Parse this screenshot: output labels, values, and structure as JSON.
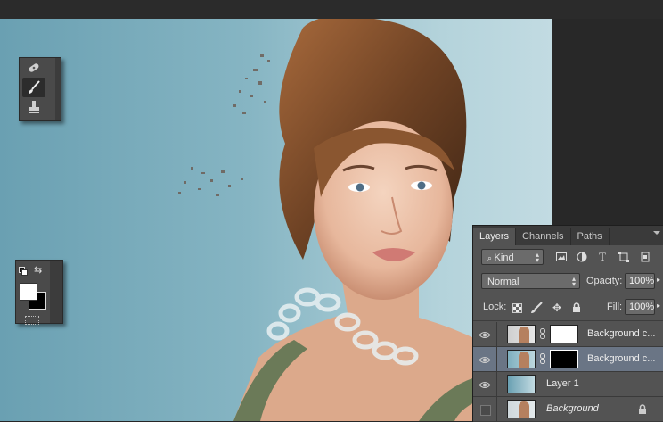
{
  "layers_panel": {
    "tabs": [
      "Layers",
      "Channels",
      "Paths"
    ],
    "filter": {
      "value": "Kind"
    },
    "blend_mode": "Normal",
    "opacity": {
      "label": "Opacity:",
      "value": "100%"
    },
    "lock_label": "Lock:",
    "fill": {
      "label": "Fill:",
      "value": "100%"
    },
    "layers": [
      {
        "name": "Background c...",
        "visible": true,
        "selected": false
      },
      {
        "name": "Background c...",
        "visible": true,
        "selected": true
      },
      {
        "name": "Layer 1",
        "visible": true,
        "selected": false
      },
      {
        "name": "Background",
        "visible": false,
        "selected": false,
        "locked": true
      }
    ]
  },
  "color_swatches": {
    "foreground": "#ffffff",
    "background": "#000000"
  },
  "colors": {
    "canvas_left": "#6aa0b2",
    "canvas_right": "#c2dbe2",
    "panel_bg": "#535353",
    "selected_layer": "#6a7585"
  },
  "icons": {
    "tools": [
      "spot-healing-brush-icon",
      "brush-icon",
      "clone-stamp-icon"
    ],
    "panel_filters": [
      "image-filter-icon",
      "adjustment-filter-icon",
      "type-filter-icon",
      "shape-filter-icon",
      "smart-object-filter-icon"
    ],
    "locks": [
      "lock-transparent-pixels-icon",
      "lock-image-pixels-icon",
      "lock-position-icon",
      "lock-all-icon"
    ]
  }
}
